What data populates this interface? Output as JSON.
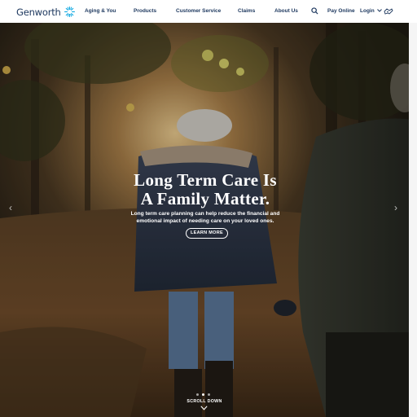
{
  "brand": {
    "name": "Genworth"
  },
  "nav": {
    "items": [
      {
        "label": "Aging & You"
      },
      {
        "label": "Products"
      },
      {
        "label": "Customer Service"
      },
      {
        "label": "Claims"
      },
      {
        "label": "About Us"
      }
    ],
    "pay_online": "Pay Online",
    "login": "Login"
  },
  "hero": {
    "headline_line1": "Long Term Care Is",
    "headline_line2": "A Family Matter.",
    "subtext": "Long term care planning can help reduce the financial and emotional impact of needing care on your loved ones.",
    "cta": "LEARN MORE",
    "scroll": "SCROLL DOWN",
    "slide_count": 3,
    "active_slide": 1
  },
  "icons": [
    "search-icon",
    "chevron-down-icon",
    "helping-hands-icon",
    "chevron-left-icon",
    "chevron-right-icon"
  ],
  "colors": {
    "brand_navy": "#1b365d",
    "brand_accent": "#00a3e0"
  }
}
